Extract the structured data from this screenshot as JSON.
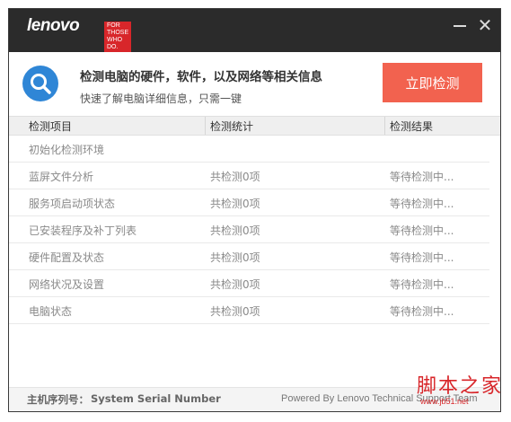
{
  "titlebar": {
    "brand": "lenovo",
    "tagline": [
      "FOR",
      "THOSE",
      "WHO DO."
    ],
    "minimize_icon": "minimize-icon",
    "close_glyph": "✕"
  },
  "header": {
    "title": "检测电脑的硬件，软件，以及网络等相关信息",
    "subtitle": "快速了解电脑详细信息，只需一键",
    "scan_button": "立即检测",
    "icon": "search-icon"
  },
  "table": {
    "columns": [
      "检测项目",
      "检测统计",
      "检测结果"
    ],
    "rows": [
      {
        "item": "初始化检测环境",
        "stat": "",
        "result": ""
      },
      {
        "item": "蓝屏文件分析",
        "stat": "共检测0项",
        "result": "等待检测中..."
      },
      {
        "item": "服务项启动项状态",
        "stat": "共检测0项",
        "result": "等待检测中..."
      },
      {
        "item": "已安装程序及补丁列表",
        "stat": "共检测0项",
        "result": "等待检测中..."
      },
      {
        "item": "硬件配置及状态",
        "stat": "共检测0项",
        "result": "等待检测中..."
      },
      {
        "item": "网络状况及设置",
        "stat": "共检测0项",
        "result": "等待检测中..."
      },
      {
        "item": "电脑状态",
        "stat": "共检测0项",
        "result": "等待检测中..."
      }
    ]
  },
  "footer": {
    "serial_label": "主机序列号：",
    "serial_value": "System Serial Number",
    "powered_by": "Powered By Lenovo Technical Support Team"
  },
  "watermark": {
    "text": "脚本之家",
    "url": "www.jb51.net"
  },
  "colors": {
    "titlebar": "#2b2b2b",
    "accent_button": "#f2624f",
    "icon_blue": "#2f86d6",
    "brand_red": "#d8262a"
  }
}
